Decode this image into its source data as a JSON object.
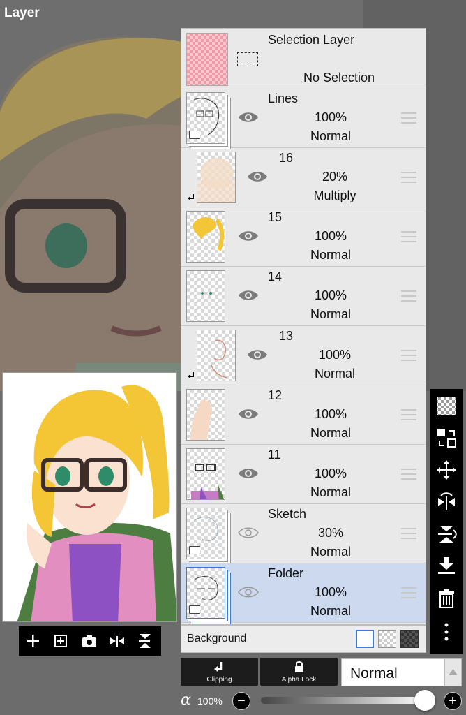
{
  "header": {
    "title": "Layer"
  },
  "selection_layer": {
    "name": "Selection Layer",
    "status": "No Selection"
  },
  "layers": [
    {
      "name": "Lines",
      "opacity": "100%",
      "blend": "Normal",
      "visible": true,
      "folder": true,
      "clipped": false,
      "selected": false
    },
    {
      "name": "16",
      "opacity": "20%",
      "blend": "Multiply",
      "visible": true,
      "folder": false,
      "clipped": true,
      "selected": false
    },
    {
      "name": "15",
      "opacity": "100%",
      "blend": "Normal",
      "visible": true,
      "folder": false,
      "clipped": false,
      "selected": false
    },
    {
      "name": "14",
      "opacity": "100%",
      "blend": "Normal",
      "visible": true,
      "folder": false,
      "clipped": false,
      "selected": false
    },
    {
      "name": "13",
      "opacity": "100%",
      "blend": "Normal",
      "visible": true,
      "folder": false,
      "clipped": true,
      "selected": false
    },
    {
      "name": "12",
      "opacity": "100%",
      "blend": "Normal",
      "visible": true,
      "folder": false,
      "clipped": false,
      "selected": false
    },
    {
      "name": "11",
      "opacity": "100%",
      "blend": "Normal",
      "visible": true,
      "folder": false,
      "clipped": false,
      "selected": false
    },
    {
      "name": "Sketch",
      "opacity": "30%",
      "blend": "Normal",
      "visible": false,
      "folder": true,
      "clipped": false,
      "selected": false
    },
    {
      "name": "Folder",
      "opacity": "100%",
      "blend": "Normal",
      "visible": false,
      "folder": true,
      "clipped": false,
      "selected": true
    }
  ],
  "background": {
    "label": "Background",
    "options": [
      "white",
      "transparent",
      "dark-checker"
    ],
    "selected": "white"
  },
  "bottom": {
    "clipping_label": "Clipping",
    "alpha_lock_label": "Alpha Lock",
    "blend_mode": "Normal",
    "alpha_symbol": "α",
    "opacity_value": "100%",
    "opacity_fraction": 1.0
  },
  "right_toolbar": [
    "transparency-checker-icon",
    "transform-layer-icon",
    "move-icon",
    "flip-horizontal-icon",
    "flip-vertical-icon",
    "merge-down-icon",
    "trash-icon",
    "more-icon"
  ],
  "left_toolbar": [
    "add-layer-icon",
    "add-layer-copy-icon",
    "camera-icon",
    "flip-horizontal-icon",
    "flip-vertical-icon"
  ],
  "colors": {
    "accent": "#3b7ad8",
    "selected_row": "#ccd9ef",
    "panel": "#e9e9e9"
  }
}
